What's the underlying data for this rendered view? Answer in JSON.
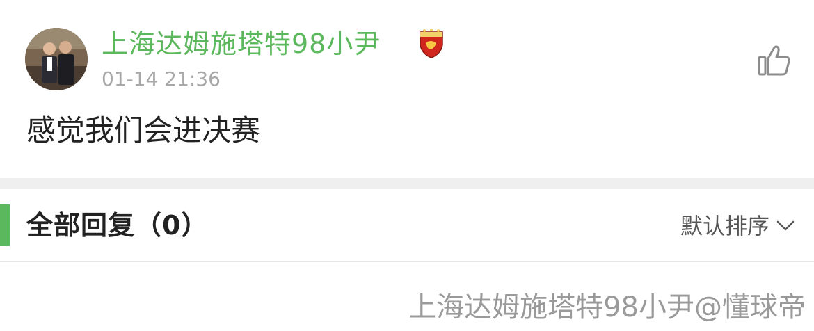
{
  "post": {
    "username": "上海达姆施塔特98小尹",
    "timestamp": "01-14 21:36",
    "content": "感觉我们会进决赛",
    "badge_icon": "shanghai-sipg-club-crest",
    "like_icon": "thumbs-up-outline"
  },
  "replies": {
    "title": "全部回复（0）",
    "sort_label": "默认排序",
    "sort_icon": "chevron-down"
  },
  "watermark": "上海达姆施塔特98小尹@懂球帝",
  "colors": {
    "accent_green": "#5cb85c",
    "timestamp_gray": "#a8a8a8",
    "band_gray": "#efefef",
    "badge_red": "#d0261e"
  }
}
